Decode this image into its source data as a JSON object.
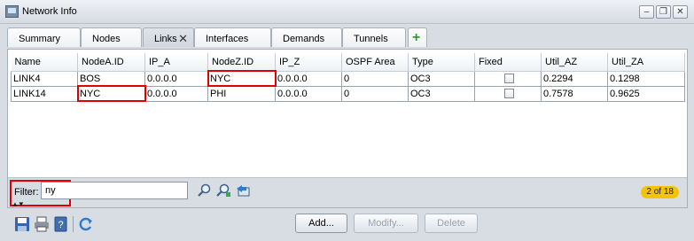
{
  "window": {
    "title": "Network Info",
    "controls": [
      "minimize",
      "restore",
      "close"
    ]
  },
  "tabs": [
    {
      "label": "Summary",
      "active": false
    },
    {
      "label": "Nodes",
      "active": false
    },
    {
      "label": "Links",
      "active": true,
      "closable": true
    },
    {
      "label": "Interfaces",
      "active": false
    },
    {
      "label": "Demands",
      "active": false
    },
    {
      "label": "Tunnels",
      "active": false
    }
  ],
  "tab_close_glyph": "✕",
  "add_tab_glyph": "+",
  "table": {
    "columns": [
      "Name",
      "NodeA.ID",
      "IP_A",
      "NodeZ.ID",
      "IP_Z",
      "OSPF Area",
      "Type",
      "Fixed",
      "Util_AZ",
      "Util_ZA"
    ],
    "rows": [
      {
        "name": "LINK4",
        "nodeA": "BOS",
        "ipA": "0.0.0.0",
        "nodeZ": "NYC",
        "ipZ": "0.0.0.0",
        "ospf": "0",
        "type": "OC3",
        "fixed": false,
        "utilAZ": "0.2294",
        "utilZA": "0.1298"
      },
      {
        "name": "LINK14",
        "nodeA": "NYC",
        "ipA": "0.0.0.0",
        "nodeZ": "PHI",
        "ipZ": "0.0.0.0",
        "ospf": "0",
        "type": "OC3",
        "fixed": false,
        "utilAZ": "0.7578",
        "utilZA": "0.9625"
      }
    ]
  },
  "filter": {
    "label": "Filter:",
    "value": "ny",
    "icons": [
      "zoom-icon",
      "zoom-select-icon",
      "export-icon"
    ]
  },
  "result_count": "2 of 18",
  "footer": {
    "icons": [
      "save-icon",
      "print-icon",
      "help-icon",
      "refresh-icon"
    ],
    "buttons": {
      "add": "Add...",
      "modify": "Modify...",
      "delete": "Delete"
    }
  },
  "colors": {
    "highlight": "#e00000",
    "badge": "#f2c500",
    "add_tab_icon": "#2f9e2f"
  }
}
